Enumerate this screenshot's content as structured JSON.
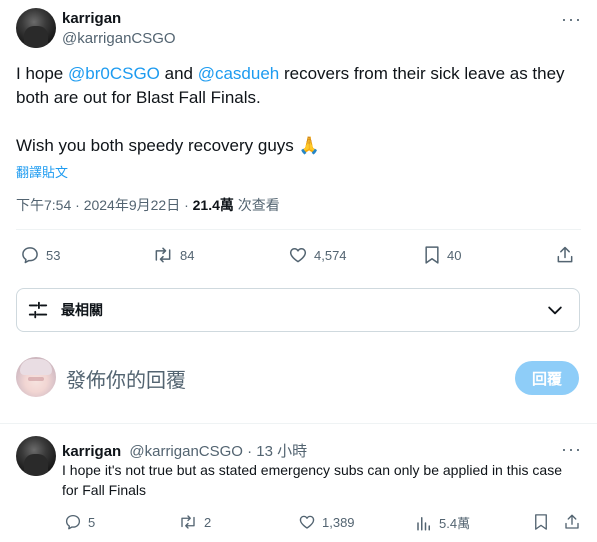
{
  "tweet": {
    "author_name": "karrigan",
    "author_handle": "@karriganCSGO",
    "more_glyph": "···",
    "text_parts": {
      "p1": "I hope ",
      "m1": "@br0CSGO",
      "p2": " and ",
      "m2": "@casdueh",
      "p3": " recovers from their sick leave as they both are out for Blast Fall Finals.",
      "p4": "Wish you both speedy recovery guys 🙏"
    },
    "translate_label": "翻譯貼文",
    "timestamp": "下午7:54 · 2024年9月22日 · ",
    "views_count": "21.4萬",
    "views_label": " 次查看",
    "stats": {
      "replies": "53",
      "reposts": "84",
      "likes": "4,574",
      "bookmarks": "40"
    }
  },
  "sort": {
    "label": "最相關"
  },
  "compose": {
    "placeholder": "發佈你的回覆",
    "button_label": "回覆"
  },
  "reply": {
    "author_name": "karrigan",
    "author_meta": "@karriganCSGO · 13 小時",
    "more_glyph": "···",
    "text": "I hope it's not true but as stated emergency subs can only be applied in this case for Fall Finals",
    "stats": {
      "replies": "5",
      "reposts": "2",
      "likes": "1,389",
      "views": "5.4萬"
    }
  },
  "colors": {
    "accent": "#1d9bf0",
    "muted": "#536471",
    "text": "#0f1419",
    "reply_button_disabled": "#8ecdf8"
  }
}
